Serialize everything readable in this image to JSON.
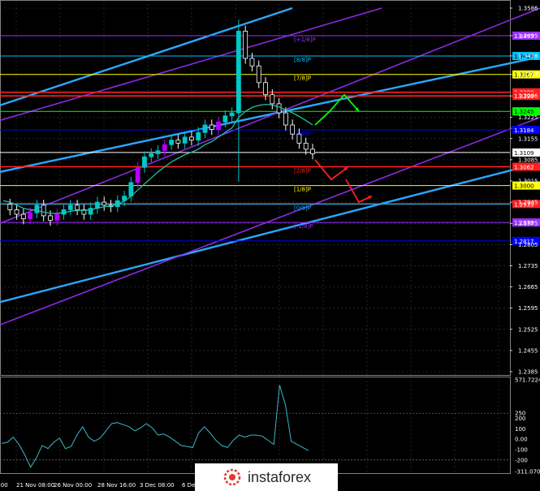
{
  "chart_data": [
    {
      "type": "line",
      "panel": "price",
      "ylim": [
        1.2385,
        1.3586
      ],
      "y_ticks": [
        "1.3586",
        "1.3495",
        "1.3428",
        "1.3367",
        "1.3296",
        "1.3225",
        "1.3155",
        "1.3085",
        "1.3015",
        "1.2945",
        "1.2875",
        "1.2805",
        "1.2735",
        "1.2665",
        "1.2595",
        "1.2525",
        "1.2455",
        "1.2385"
      ],
      "date_labels": [
        "21 Nov 08:00",
        "26 Nov 00:00",
        "28 Nov 16:00",
        "3 Dec 08:00",
        "6 Dec"
      ],
      "date_label_partial": "0:00",
      "murrey_levels": [
        {
          "label": "[+1/8]P",
          "price": 1.3495,
          "color": "#9b30ff",
          "tag": "1.3495"
        },
        {
          "label": "[8/8]P",
          "price": 1.3428,
          "color": "#00bfff",
          "tag": "1.3428"
        },
        {
          "label": "[7/8]P",
          "price": 1.3367,
          "color": "#ffff00",
          "tag": "1.3367"
        },
        {
          "label": "",
          "price": 1.3308,
          "color": "#ff2020",
          "tag": "1.3308"
        },
        {
          "label": "",
          "price": 1.3296,
          "color": "#ff2020",
          "tag": "1.3296"
        },
        {
          "label": "",
          "price": 1.3245,
          "color": "#00ff00",
          "tag": "1.3245"
        },
        {
          "label": "[5/8]P",
          "price": 1.3184,
          "color": "#0000ff",
          "tag": "1.3184"
        },
        {
          "label": "",
          "price": 1.3109,
          "color": "#ffffff",
          "tag": "1.3109"
        },
        {
          "label": "[2/8]P",
          "price": 1.3062,
          "color": "#ff2020",
          "tag": "1.3062"
        },
        {
          "label": "[1/8]P",
          "price": 1.3,
          "color": "#ffff00",
          "tag": "1.3000"
        },
        {
          "label": "",
          "price": 1.2939,
          "color": "#ff2020",
          "tag": "1.2939"
        },
        {
          "label": "[0/8]P",
          "price": 1.2939,
          "color": "#00bfff",
          "tag": ""
        },
        {
          "label": "[-1/8]P",
          "price": 1.2878,
          "color": "#9b30ff",
          "tag": "1.2878"
        },
        {
          "label": "",
          "price": 1.2817,
          "color": "#0000ff",
          "tag": "1.2817"
        }
      ],
      "price_series_close": [
        1.2938,
        1.292,
        1.2905,
        1.289,
        1.291,
        1.2935,
        1.29,
        1.2885,
        1.2905,
        1.292,
        1.2935,
        1.292,
        1.2905,
        1.2925,
        1.2945,
        1.2935,
        1.293,
        1.295,
        1.2965,
        1.301,
        1.306,
        1.3095,
        1.3105,
        1.3115,
        1.3135,
        1.315,
        1.314,
        1.316,
        1.315,
        1.3175,
        1.32,
        1.3185,
        1.321,
        1.323,
        1.324,
        1.351,
        1.342,
        1.3395,
        1.334,
        1.33,
        1.327,
        1.324,
        1.32,
        1.317,
        1.314,
        1.312,
        1.3105
      ],
      "ma_series": [
        1.295,
        1.2945,
        1.2935,
        1.2925,
        1.292,
        1.2918,
        1.2912,
        1.2908,
        1.2908,
        1.291,
        1.2915,
        1.2918,
        1.2918,
        1.292,
        1.2925,
        1.293,
        1.2932,
        1.2938,
        1.2948,
        1.2965,
        1.2985,
        1.3005,
        1.3025,
        1.3045,
        1.3062,
        1.3078,
        1.309,
        1.3102,
        1.311,
        1.312,
        1.3135,
        1.3145,
        1.316,
        1.3175,
        1.319,
        1.3225,
        1.3245,
        1.3258,
        1.3265,
        1.3268,
        1.3266,
        1.326,
        1.325,
        1.324,
        1.3228,
        1.3215,
        1.32
      ],
      "forecast_arrows": [
        {
          "color": "#00ff00",
          "points": [
            [
              1.32,
              0
            ],
            [
              1.3245,
              1
            ],
            [
              1.33,
              2
            ],
            [
              1.3245,
              3
            ]
          ]
        },
        {
          "color": "#ff2020",
          "points": [
            [
              1.3085,
              0
            ],
            [
              1.302,
              1
            ],
            [
              1.306,
              2
            ]
          ]
        },
        {
          "color": "#ff2020",
          "points": [
            [
              1.302,
              0
            ],
            [
              1.2945,
              1
            ],
            [
              1.2965,
              2
            ]
          ]
        }
      ]
    },
    {
      "type": "line",
      "panel": "oscillator",
      "ylim": [
        -311.0708,
        571.7224
      ],
      "y_ticks": [
        "571.7224",
        "250",
        "200",
        "100",
        "0.00",
        "-100",
        "-200",
        "-311.0708"
      ],
      "values": [
        -40,
        -30,
        20,
        -50,
        -150,
        -270,
        -180,
        -60,
        -90,
        -30,
        10,
        -90,
        -70,
        40,
        120,
        20,
        -20,
        10,
        80,
        150,
        160,
        140,
        120,
        80,
        110,
        150,
        110,
        40,
        50,
        20,
        -20,
        -60,
        -70,
        -80,
        60,
        120,
        60,
        -10,
        -60,
        -80,
        -10,
        40,
        20,
        40,
        40,
        30,
        -10,
        -50,
        520,
        330,
        -20,
        -50,
        -80,
        -110
      ]
    }
  ],
  "branding": {
    "logo_text": "instaforex"
  },
  "colors": {
    "background": "#000000",
    "candle_up": "#00c8c8",
    "candle_down": "#ffffff",
    "candle_up_alt": "#b400ff",
    "ma": "#20c0a0",
    "channel_blue": "#2aa8ff",
    "channel_purple": "#8a2be2",
    "oscillator_line": "#3ab8c8"
  }
}
